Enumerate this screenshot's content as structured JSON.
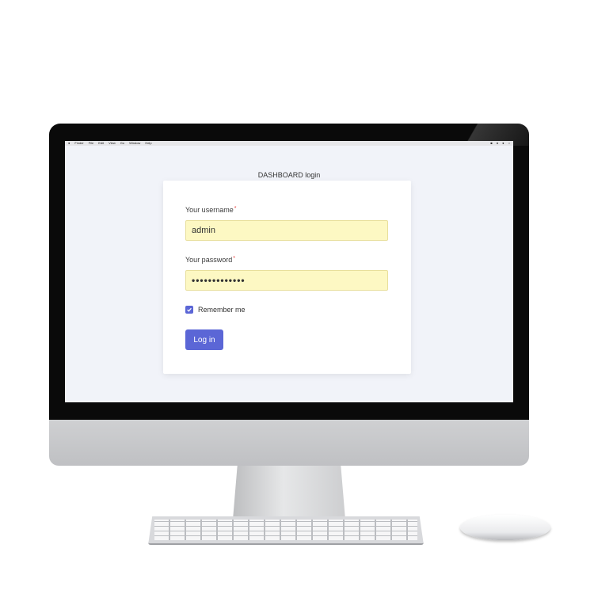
{
  "page": {
    "title": "DASHBOARD login"
  },
  "menubar": {
    "items": [
      "Finder",
      "File",
      "Edit",
      "View",
      "Go",
      "Window",
      "Help"
    ]
  },
  "form": {
    "username_label": "Your username",
    "username_value": "admin",
    "password_label": "Your password",
    "password_value": "•••••••••••••",
    "required_marker": "*",
    "remember_label": "Remember me",
    "remember_checked": true,
    "login_button": "Log in"
  },
  "colors": {
    "accent": "#5b66d6",
    "autofill_bg": "#fdf8c3",
    "screen_bg": "#f1f3f9",
    "required": "#e53935"
  }
}
